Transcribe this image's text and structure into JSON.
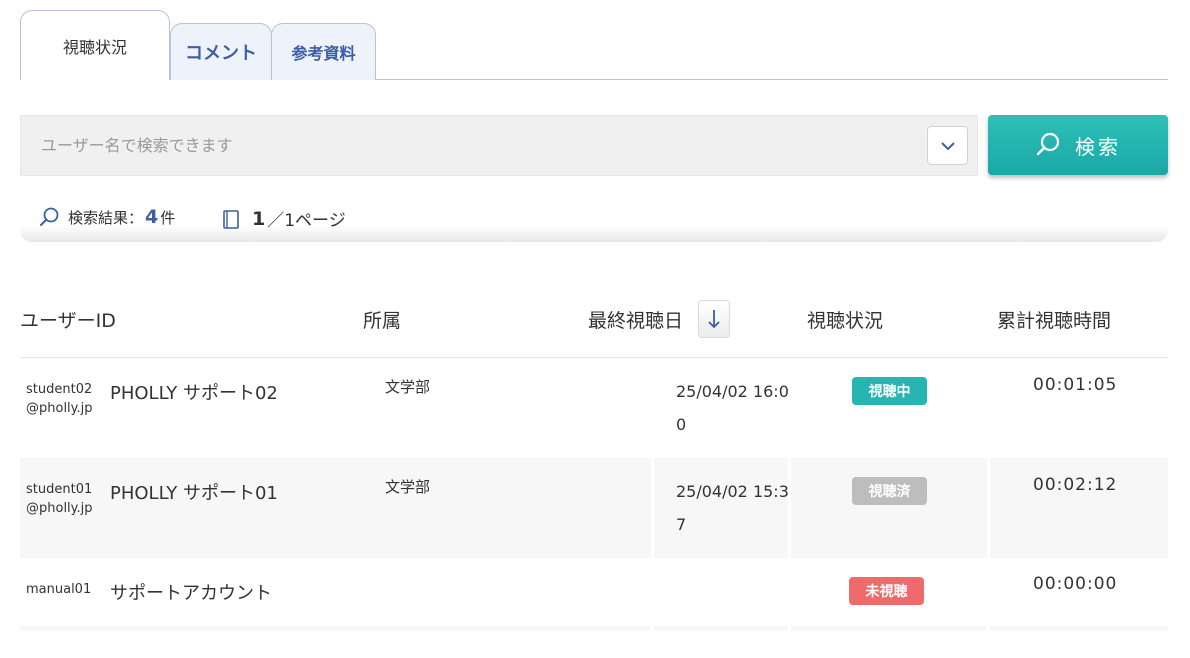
{
  "tabs": [
    {
      "label": "視聴状況"
    },
    {
      "label": "コメント"
    },
    {
      "label": "参考資料"
    }
  ],
  "search": {
    "placeholder": "ユーザー名で検索できます",
    "button_label": "検索"
  },
  "result": {
    "prefix": "検索結果：",
    "count": "4",
    "suffix": "件",
    "page_current": "1",
    "page_rest": "／1ページ"
  },
  "table": {
    "headers": {
      "user_id": "ユーザーID",
      "dept": "所属",
      "last_viewed": "最終視聴日",
      "status": "視聴状況",
      "total_time": "累計視聴時間"
    },
    "rows": [
      {
        "uid1": "student02",
        "uid2": "@pholly.jp",
        "name": "PHOLLY サポート02",
        "dept": "文学部",
        "date": "25/04/02 16:00",
        "status": "視聴中",
        "status_color": "#26b5b0",
        "duration": "00:01:05"
      },
      {
        "uid1": "student01",
        "uid2": "@pholly.jp",
        "name": "PHOLLY サポート01",
        "dept": "文学部",
        "date": "25/04/02 15:37",
        "status": "視聴済",
        "status_color": "#bdbdbd",
        "duration": "00:02:12"
      },
      {
        "uid1": "manual01",
        "uid2": "",
        "name": "サポートアカウント",
        "dept": "",
        "date": "",
        "status": "未視聴",
        "status_color": "#ef6b6b",
        "duration": "00:00:00"
      }
    ]
  },
  "colors": {
    "accent": "#1fb1ad",
    "tab_text": "#3d5ea5",
    "tab_bg": "#eef2fb"
  }
}
